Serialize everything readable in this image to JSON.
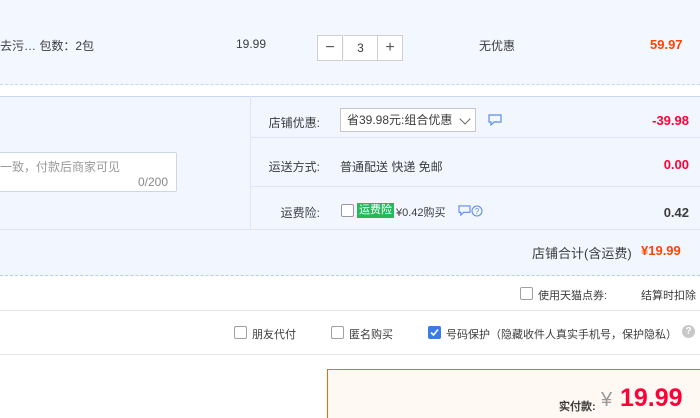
{
  "item": {
    "desc": "去污… 包数：2包",
    "unit_price": "19.99",
    "quantity": "3",
    "minus_symbol": "−",
    "plus_symbol": "+",
    "discount": "无优惠",
    "total": "59.97"
  },
  "shop": {
    "memo_placeholder": "一致，付款后商家可见",
    "memo_count": "0/200",
    "coupon_label": "店铺优惠:",
    "coupon_selected": "省39.98元:组合优惠",
    "coupon_amount": "-39.98",
    "shipping_label": "运送方式:",
    "shipping_value": "普通配送 快递 免邮",
    "shipping_amount": "0.00",
    "insurance_label": "运费险:",
    "insurance_tag": "运费险",
    "insurance_text": "¥0.42购买",
    "insurance_amount": "0.42",
    "total_label": "店铺合计(含运费)",
    "total_value": "¥19.99"
  },
  "points": {
    "label": "使用天猫点券:",
    "note": "结算时扣除"
  },
  "options": {
    "friend_pay": "朋友代付",
    "anonymous": "匿名购买",
    "number_protect": "号码保护（隐藏收件人真实手机号，保护隐私）",
    "help_symbol": "?"
  },
  "payment": {
    "label": "实付款:",
    "currency": "¥",
    "amount": "19.99"
  },
  "colors": {
    "price_orange": "#ff4400",
    "discount_red": "#ff0036",
    "accent_blue": "#3a7be6",
    "insurance_green": "#28b85c"
  }
}
